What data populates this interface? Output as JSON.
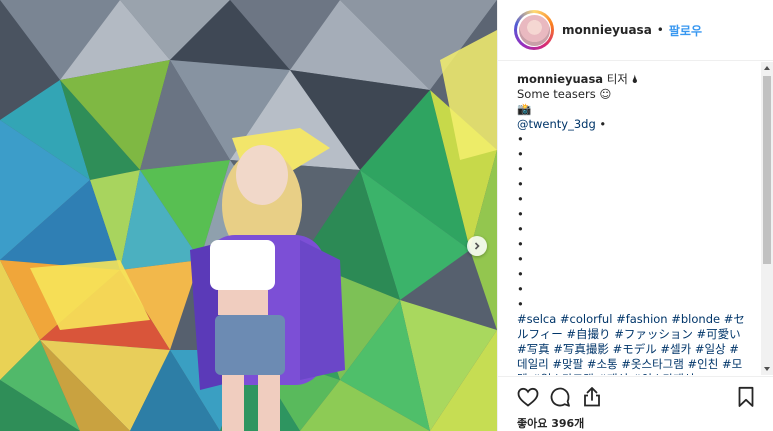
{
  "post": {
    "photo_description_icon": "photo",
    "next_icon": "chevron-right-icon"
  },
  "header": {
    "username": "monnieyuasa",
    "separator": "•",
    "follow_label": "팔로우"
  },
  "caption": {
    "username": "monnieyuasa",
    "title_text": "티저 🌢",
    "line2": "Some teasers ☺",
    "line3": "📸",
    "mention": "@twenty_3dg",
    "mention_suffix": " •",
    "bullets": [
      "•",
      "•",
      "•",
      "•",
      "•",
      "•",
      "•",
      "•",
      "•",
      "•",
      "•",
      "•"
    ],
    "hashtags": "#selca #colorful #fashion #blonde #セルフィー #自撮り #ファッション #可愛い #写真 #写真撮影 #モデル #셀카 #일상 #데일리 #맞팔 #소통 #옷스타그램 #인친 #모델 #얼스타그램 #패션 #인스타패션"
  },
  "actions": {
    "like_icon": "heart-icon",
    "comment_icon": "comment-icon",
    "share_icon": "share-icon",
    "save_icon": "bookmark-icon",
    "likes_text": "좋아요 396개"
  }
}
